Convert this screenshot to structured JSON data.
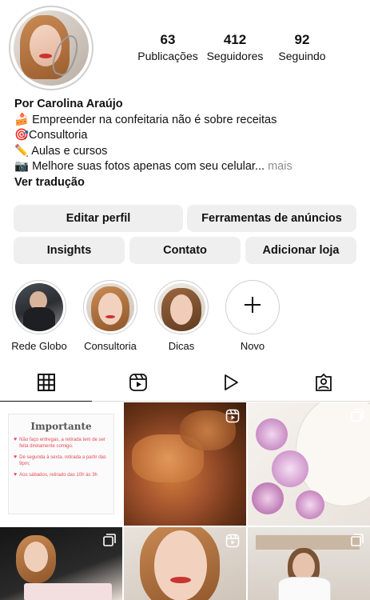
{
  "profile": {
    "stats": [
      {
        "value": "63",
        "label": "Publicações"
      },
      {
        "value": "412",
        "label": "Seguidores"
      },
      {
        "value": "92",
        "label": "Seguindo"
      }
    ],
    "name": "Por Carolina Araújo",
    "bio_lines": [
      "🍰 Empreender na confeitaria não é sobre receitas",
      "🎯Consultoria",
      "✏️ Aulas e cursos",
      "📷 Melhore suas fotos apenas com seu celular..."
    ],
    "more_label": "mais",
    "translate_label": "Ver tradução"
  },
  "buttons": {
    "edit_profile": "Editar perfil",
    "ad_tools": "Ferramentas de anúncios",
    "insights": "Insights",
    "contact": "Contato",
    "add_shop": "Adicionar loja"
  },
  "highlights": [
    {
      "label": "Rede Globo"
    },
    {
      "label": "Consultoria"
    },
    {
      "label": "Dicas"
    },
    {
      "label": "Novo",
      "icon": "plus-icon"
    }
  ],
  "tabs": [
    {
      "name": "grid-icon",
      "active": true
    },
    {
      "name": "reels-icon",
      "active": false
    },
    {
      "name": "play-icon",
      "active": false
    },
    {
      "name": "tagged-icon",
      "active": false
    }
  ],
  "posts": {
    "notice": {
      "title": "Importante",
      "lines": [
        "Não faço entregas, a retirada tem de ser feita diretamente comigo.",
        "De segunda à sexta, retirada a partir das 9pm;",
        "Aos sábados, retirado das 10h às 3h"
      ]
    }
  },
  "colors": {
    "button_bg": "#efefef",
    "accent_red": "#e04b57",
    "muted_text": "#8e8e8e"
  }
}
